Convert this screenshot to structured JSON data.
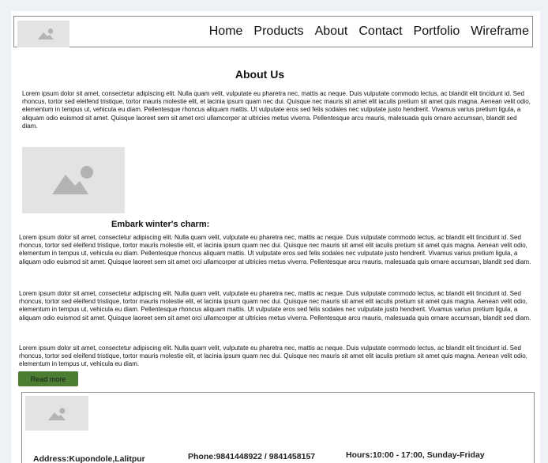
{
  "nav": {
    "items": [
      "Home",
      "Products",
      "About",
      "Contact",
      "Portfolio",
      "Wireframe"
    ]
  },
  "about": {
    "title": "About Us",
    "intro": "Lorem ipsum dolor sit amet, consectetur adipiscing elit. Nulla quam velit, vulputate eu pharetra nec, mattis ac neque. Duis vulputate commodo lectus, ac blandit elit tincidunt id. Sed rhoncus, tortor sed eleifend tristique, tortor mauris molestie elit, et lacinia ipsum quam nec dui. Quisque nec mauris sit amet elit iaculis pretium sit amet quis magna. Aenean velit odio, elementum in tempus ut, vehicula eu diam. Pellentesque rhoncus aliquam mattis. Ut vulputate eros sed felis sodales nec vulputate justo hendrerit. Vivamus varius pretium ligula, a aliquam odio euismod sit amet. Quisque laoreet sem sit amet orci ullamcorper at ultricies metus viverra. Pellentesque arcu mauris, malesuada quis ornare accumsan, blandit sed diam.",
    "subtitle": "Embark winter's charm:",
    "para1": "Lorem ipsum dolor sit amet, consectetur adipiscing elit. Nulla quam velit, vulputate eu pharetra nec, mattis ac neque. Duis vulputate commodo lectus, ac blandit elit tincidunt id. Sed rhoncus, tortor sed eleifend tristique, tortor mauris molestie elit, et lacinia ipsum quam nec dui. Quisque nec mauris sit amet elit iaculis pretium sit amet quis magna. Aenean velit odio, elementum in tempus ut, vehicula eu diam. Pellentesque rhoncus aliquam mattis. Ut vulputate eros sed felis sodales nec vulputate justo hendrerit. Vivamus varius pretium ligula, a aliquam odio euismod sit amet. Quisque laoreet sem sit amet orci ullamcorper at ultricies metus viverra. Pellentesque arcu mauris, malesuada quis ornare accumsan, blandit sed diam.",
    "para2": "Lorem ipsum dolor sit amet, consectetur adipiscing elit. Nulla quam velit, vulputate eu pharetra nec, mattis ac neque. Duis vulputate commodo lectus, ac blandit elit tincidunt id. Sed rhoncus, tortor sed eleifend tristique, tortor mauris molestie elit, et lacinia ipsum quam nec dui. Quisque nec mauris sit amet elit iaculis pretium sit amet quis magna. Aenean velit odio, elementum in tempus ut, vehicula eu diam. Pellentesque rhoncus aliquam mattis. Ut vulputate eros sed felis sodales nec vulputate justo hendrerit. Vivamus varius pretium ligula, a aliquam odio euismod sit amet. Quisque laoreet sem sit amet orci ullamcorper at ultricies metus viverra. Pellentesque arcu mauris, malesuada quis ornare accumsan, blandit sed diam.",
    "para3": "Lorem ipsum dolor sit amet, consectetur adipiscing elit. Nulla quam velit, vulputate eu pharetra nec, mattis ac neque. Duis vulputate commodo lectus, ac blandit elit tincidunt id. Sed rhoncus, tortor sed eleifend tristique, tortor mauris molestie elit, et lacinia ipsum quam nec dui. Quisque nec mauris sit amet elit iaculis pretium sit amet quis magna. Aenean velit odio, elementum in tempus ut, vehicula eu diam.",
    "read_more": "Read more"
  },
  "footer": {
    "address": "Address:Kupondole,Lalitpur",
    "phone": "Phone:9841448922 / 9841458157",
    "hours": "Hours:10:00 - 17:00, Sunday-Friday"
  },
  "colors": {
    "button_bg": "#4b7d32",
    "placeholder_bg": "#e3e3e3",
    "placeholder_icon": "#b3b3b3"
  },
  "icons": {
    "logo": "image-placeholder-icon",
    "about_image": "image-placeholder-icon",
    "footer_logo": "image-placeholder-icon"
  }
}
